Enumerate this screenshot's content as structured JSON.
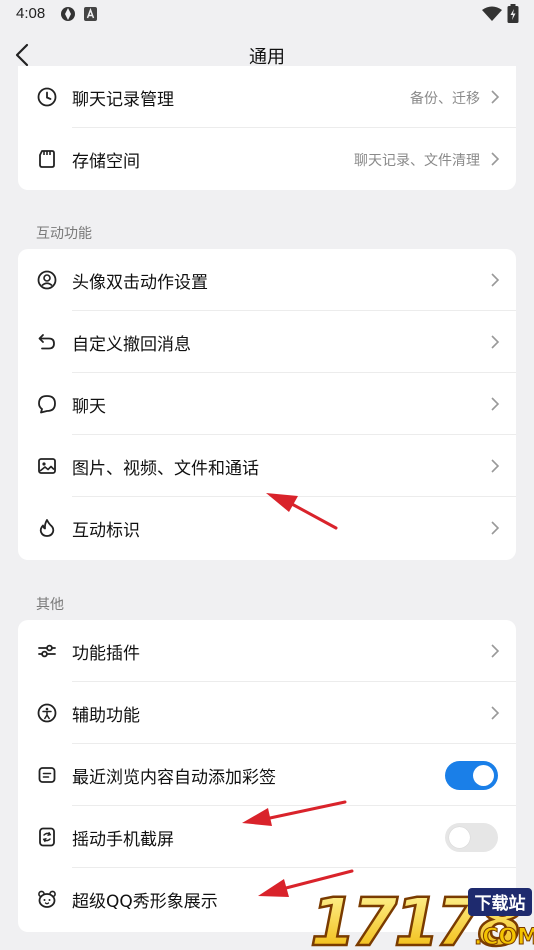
{
  "status_bar": {
    "time": "4:08"
  },
  "header": {
    "title": "通用"
  },
  "storage_card": {
    "items": [
      {
        "label": "聊天记录管理",
        "value": "备份、迁移"
      },
      {
        "label": "存储空间",
        "value": "聊天记录、文件清理"
      }
    ]
  },
  "interaction": {
    "title": "互动功能",
    "items": [
      {
        "label": "头像双击动作设置"
      },
      {
        "label": "自定义撤回消息"
      },
      {
        "label": "聊天"
      },
      {
        "label": "图片、视频、文件和通话"
      },
      {
        "label": "互动标识"
      }
    ]
  },
  "other": {
    "title": "其他",
    "items": [
      {
        "label": "功能插件"
      },
      {
        "label": "辅助功能"
      },
      {
        "label": "最近浏览内容自动添加彩签",
        "toggle": "on"
      },
      {
        "label": "摇动手机截屏",
        "toggle": "off"
      },
      {
        "label": "超级QQ秀形象展示"
      }
    ]
  },
  "watermark": {
    "brand": "17178",
    "badge": "下载站",
    "suffix": ".COM"
  },
  "colors": {
    "accent": "#1a7fe8",
    "annotation": "#d9232b",
    "background": "#f0f0f2"
  }
}
